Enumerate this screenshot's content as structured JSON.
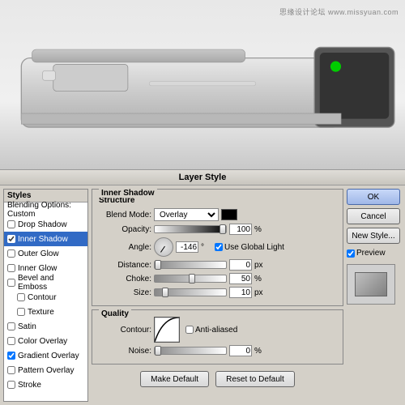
{
  "watermark": "思缘设计论坛  www.missyuan.com",
  "dialog": {
    "title": "Layer Style",
    "ok_label": "OK",
    "cancel_label": "Cancel",
    "new_style_label": "New Style...",
    "preview_label": "Preview"
  },
  "styles": {
    "header": "Styles",
    "items": [
      {
        "label": "Blending Options: Custom",
        "checked": false,
        "selected": false
      },
      {
        "label": "Drop Shadow",
        "checked": false,
        "selected": false
      },
      {
        "label": "Inner Shadow",
        "checked": true,
        "selected": true
      },
      {
        "label": "Outer Glow",
        "checked": false,
        "selected": false
      },
      {
        "label": "Inner Glow",
        "checked": false,
        "selected": false
      },
      {
        "label": "Bevel and Emboss",
        "checked": false,
        "selected": false
      },
      {
        "label": "Contour",
        "checked": false,
        "selected": false,
        "indent": true
      },
      {
        "label": "Texture",
        "checked": false,
        "selected": false,
        "indent": true
      },
      {
        "label": "Satin",
        "checked": false,
        "selected": false
      },
      {
        "label": "Color Overlay",
        "checked": false,
        "selected": false
      },
      {
        "label": "Gradient Overlay",
        "checked": true,
        "selected": false
      },
      {
        "label": "Pattern Overlay",
        "checked": false,
        "selected": false
      },
      {
        "label": "Stroke",
        "checked": false,
        "selected": false
      }
    ]
  },
  "inner_shadow": {
    "section_title": "Inner Shadow",
    "structure_title": "Structure",
    "blend_mode_label": "Blend Mode:",
    "blend_mode_value": "Overlay",
    "opacity_label": "Opacity:",
    "opacity_value": "100",
    "opacity_unit": "%",
    "angle_label": "Angle:",
    "angle_value": "-146",
    "angle_unit": "°",
    "global_light_label": "Use Global Light",
    "distance_label": "Distance:",
    "distance_value": "0",
    "distance_unit": "px",
    "choke_label": "Choke:",
    "choke_value": "50",
    "choke_unit": "%",
    "size_label": "Size:",
    "size_value": "10",
    "size_unit": "px",
    "quality_title": "Quality",
    "contour_label": "Contour:",
    "anti_alias_label": "Anti-aliased",
    "noise_label": "Noise:",
    "noise_value": "0",
    "noise_unit": "%"
  },
  "bottom": {
    "make_default": "Make Default",
    "reset_to_default": "Reset to Default"
  }
}
